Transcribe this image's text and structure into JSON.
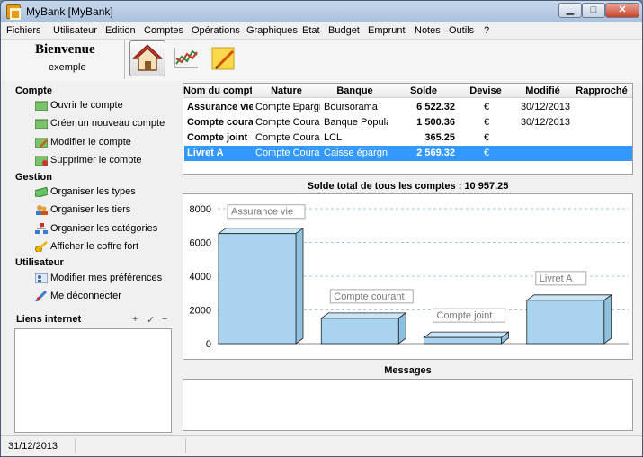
{
  "window": {
    "title": "MyBank [MyBank]"
  },
  "menu": [
    "Fichiers",
    "Utilisateur",
    "Edition",
    "Comptes",
    "Opérations",
    "Graphiques",
    "Etat",
    "Budget",
    "Emprunt",
    "Notes",
    "Outils",
    "?"
  ],
  "welcome": {
    "title": "Bienvenue",
    "user": "exemple"
  },
  "toolbar": {
    "icons": [
      "home-icon",
      "chart-icon",
      "note-icon"
    ]
  },
  "sidebar": {
    "compte_title": "Compte",
    "compte_items": [
      "Ouvrir le compte",
      "Créer un nouveau compte",
      "Modifier le compte",
      "Supprimer le compte"
    ],
    "gestion_title": "Gestion",
    "gestion_items": [
      "Organiser les types",
      "Organiser les tiers",
      "Organiser les catégories",
      "Afficher le coffre fort"
    ],
    "utilisateur_title": "Utilisateur",
    "utilisateur_items": [
      "Modifier mes préférences",
      "Me déconnecter"
    ],
    "liens_title": "Liens internet",
    "liens_tools": [
      "+",
      "✓",
      "−"
    ]
  },
  "accounts": {
    "columns": [
      "Nom du compte",
      "Nature",
      "Banque",
      "Solde",
      "Devise",
      "Modifié",
      "Rapproché"
    ],
    "rows": [
      {
        "nom": "Assurance vie",
        "nature": "Compte Epargne",
        "banque": "Boursorama",
        "solde": "6 522.32",
        "devise": "€",
        "modifie": "30/12/2013",
        "rapproche": ""
      },
      {
        "nom": "Compte courant",
        "nature": "Compte Courant",
        "banque": "Banque Populaire",
        "solde": "1 500.36",
        "devise": "€",
        "modifie": "30/12/2013",
        "rapproche": ""
      },
      {
        "nom": "Compte joint",
        "nature": "Compte Courant",
        "banque": "LCL",
        "solde": "365.25",
        "devise": "€",
        "modifie": "",
        "rapproche": ""
      },
      {
        "nom": "Livret A",
        "nature": "Compte Courant",
        "banque": "Caisse épargne",
        "solde": "2 569.32",
        "devise": "€",
        "modifie": "",
        "rapproche": ""
      }
    ],
    "selected_index": 3,
    "total_label": "Solde total de tous les comptes : 10 957.25"
  },
  "chart_data": {
    "type": "bar",
    "categories": [
      "Assurance vie",
      "Compte courant",
      "Compte joint",
      "Livret A"
    ],
    "values": [
      6522.32,
      1500.36,
      365.25,
      2569.32
    ],
    "ylim": [
      0,
      8000
    ],
    "yticks": [
      "0",
      "2000",
      "4000",
      "6000",
      "8000"
    ],
    "bar_color": "#a8d4ef",
    "bar_side_color": "#8ec0e0",
    "grid": true,
    "style": "3d"
  },
  "messages": {
    "title": "Messages"
  },
  "status": {
    "date": "31/12/2013"
  }
}
